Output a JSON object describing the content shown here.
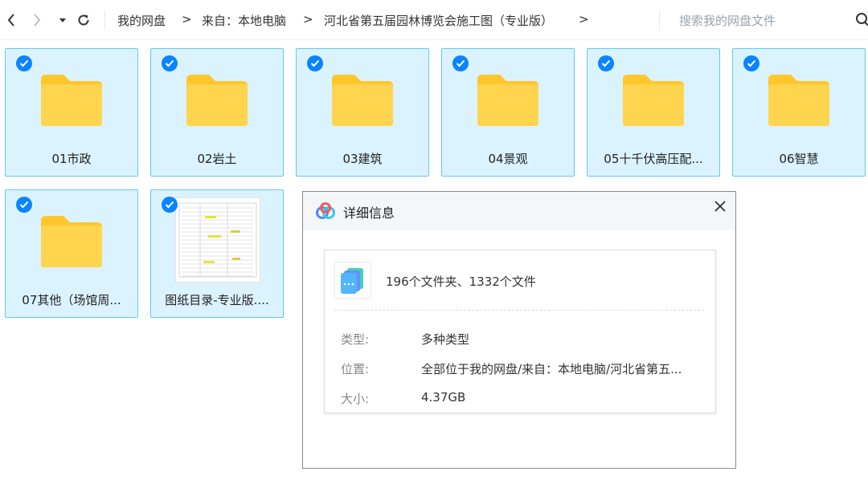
{
  "toolbar": {
    "breadcrumb": [
      "我的网盘",
      "来自：本地电脑",
      "河北省第五届园林博览会施工图（专业版）"
    ],
    "separator": ">",
    "search_placeholder": "搜索我的网盘文件"
  },
  "items": [
    {
      "label": "01市政",
      "type": "folder",
      "selected": true
    },
    {
      "label": "02岩土",
      "type": "folder",
      "selected": true
    },
    {
      "label": "03建筑",
      "type": "folder",
      "selected": true
    },
    {
      "label": "04景观",
      "type": "folder",
      "selected": true
    },
    {
      "label": "05十千伏高压配...",
      "type": "folder",
      "selected": true
    },
    {
      "label": "06智慧",
      "type": "folder",
      "selected": true
    },
    {
      "label": "07其他（场馆周...",
      "type": "folder",
      "selected": true
    },
    {
      "label": "图纸目录-专业版....",
      "type": "document",
      "selected": true
    }
  ],
  "dialog": {
    "title": "详细信息",
    "summary": "196个文件夹、1332个文件",
    "rows": [
      {
        "label": "类型:",
        "value": "多种类型"
      },
      {
        "label": "位置:",
        "value": "全部位于我的网盘/来自：本地电脑/河北省第五..."
      },
      {
        "label": "大小:",
        "value": "4.37GB"
      }
    ]
  },
  "colors": {
    "accent": "#0a84ff",
    "tile_bg": "#dbf3fe",
    "tile_border": "#66c8f0",
    "folder": "#ffd54f"
  }
}
